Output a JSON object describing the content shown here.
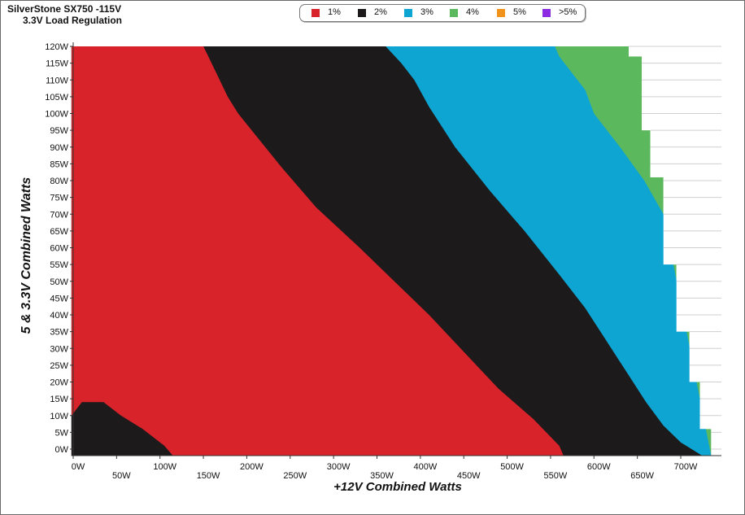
{
  "chart_data": {
    "type": "heatmap",
    "title": "SilverStone SX750 -115V",
    "subtitle": "3.3V Load Regulation",
    "xlabel": "+12V Combined Watts",
    "ylabel": "5 & 3.3V Combined Watts",
    "xlim": [
      0,
      750
    ],
    "ylim": [
      -2,
      120
    ],
    "x_ticks": [
      "0W",
      "50W",
      "100W",
      "150W",
      "200W",
      "250W",
      "300W",
      "350W",
      "400W",
      "450W",
      "500W",
      "550W",
      "600W",
      "650W",
      "700W"
    ],
    "y_ticks": [
      "0W",
      "5W",
      "10W",
      "15W",
      "20W",
      "25W",
      "30W",
      "35W",
      "40W",
      "45W",
      "50W",
      "55W",
      "60W",
      "65W",
      "70W",
      "75W",
      "80W",
      "85W",
      "90W",
      "95W",
      "100W",
      "105W",
      "110W",
      "115W",
      "120W"
    ],
    "grid": true,
    "legend_position": "top",
    "legend": [
      {
        "label": "1%",
        "color": "#d8232a"
      },
      {
        "label": "2%",
        "color": "#1c1a1b"
      },
      {
        "label": "3%",
        "color": "#0ea5d2"
      },
      {
        "label": "4%",
        "color": "#5cb85c"
      },
      {
        "label": "5%",
        "color": "#f0931d"
      },
      {
        "label": ">5%",
        "color": "#8b2be2"
      }
    ],
    "boundaries": {
      "max_load": [
        [
          0,
          120
        ],
        [
          640,
          120
        ],
        [
          640,
          117
        ],
        [
          655,
          117
        ],
        [
          655,
          95
        ],
        [
          665,
          95
        ],
        [
          665,
          81
        ],
        [
          680,
          81
        ],
        [
          680,
          55
        ],
        [
          695,
          55
        ],
        [
          695,
          35
        ],
        [
          710,
          35
        ],
        [
          710,
          20
        ],
        [
          722,
          20
        ],
        [
          722,
          6
        ],
        [
          735,
          6
        ],
        [
          735,
          -2
        ]
      ],
      "band_4pct_edge": [
        [
          555,
          120
        ],
        [
          560,
          117
        ],
        [
          590,
          107
        ],
        [
          600,
          100
        ],
        [
          630,
          90
        ],
        [
          658,
          80
        ]
      ],
      "band_3pct_edge": [
        [
          360,
          120
        ],
        [
          378,
          115
        ],
        [
          393,
          110
        ],
        [
          410,
          102
        ],
        [
          440,
          90
        ],
        [
          480,
          77
        ],
        [
          520,
          65
        ],
        [
          560,
          52
        ],
        [
          590,
          42
        ],
        [
          615,
          32
        ],
        [
          640,
          22
        ],
        [
          660,
          14
        ],
        [
          680,
          7
        ],
        [
          700,
          2
        ],
        [
          725,
          -2
        ]
      ],
      "band_2pct_edge": [
        [
          150,
          120
        ],
        [
          165,
          112
        ],
        [
          178,
          105
        ],
        [
          190,
          100
        ],
        [
          215,
          92
        ],
        [
          240,
          84
        ],
        [
          280,
          72
        ],
        [
          330,
          60
        ],
        [
          370,
          50
        ],
        [
          410,
          40
        ],
        [
          450,
          29
        ],
        [
          490,
          18
        ],
        [
          530,
          9
        ],
        [
          560,
          1
        ],
        [
          565,
          -2
        ]
      ],
      "low_load_2pct_region": [
        [
          -2,
          10
        ],
        [
          10,
          14
        ],
        [
          35,
          14
        ],
        [
          55,
          10
        ],
        [
          80,
          6
        ],
        [
          105,
          1
        ],
        [
          115,
          -2
        ],
        [
          -2,
          -2
        ]
      ]
    }
  }
}
